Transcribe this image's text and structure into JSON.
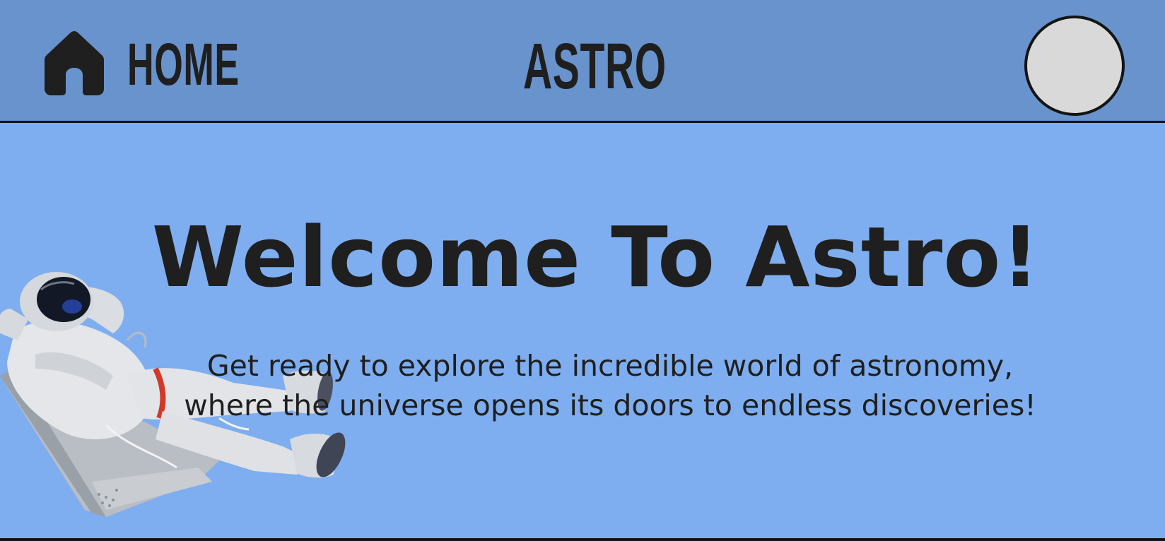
{
  "header": {
    "home_label": "HOME",
    "home_icon": "home-icon",
    "brand": "ASTRO",
    "avatar": "profile-avatar"
  },
  "hero": {
    "title": "Welcome To Astro!",
    "subtitle": "Get ready to explore the incredible world of astronomy, where the universe opens its doors to endless discoveries!",
    "illustration": "astronaut-illustration"
  },
  "colors": {
    "header_bg": "#6893cc",
    "page_bg": "#7eaef0",
    "text": "#1f1f1f",
    "avatar_bg": "#d9d9d9"
  }
}
